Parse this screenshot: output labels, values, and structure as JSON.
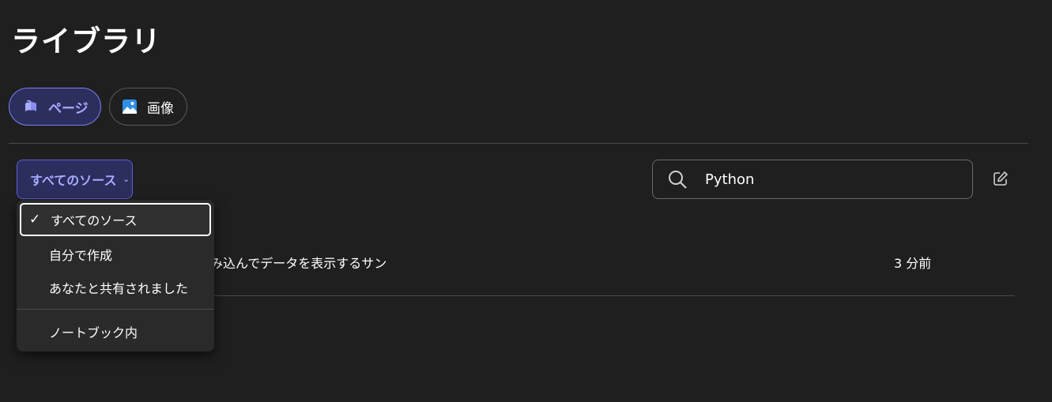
{
  "page": {
    "title": "ライブラリ"
  },
  "tabs": [
    {
      "label": "ページ",
      "icon": "pages-icon",
      "active": true
    },
    {
      "label": "画像",
      "icon": "image-icon",
      "active": false
    }
  ],
  "filter": {
    "label": "すべてのソース",
    "options": [
      {
        "label": "すべてのソース",
        "selected": true
      },
      {
        "label": "自分で作成",
        "selected": false
      },
      {
        "label": "あなたと共有されました",
        "selected": false
      },
      {
        "label": "ノートブック内",
        "selected": false
      }
    ]
  },
  "search": {
    "value": "Python",
    "icon": "search-icon"
  },
  "list": {
    "rows": [
      {
        "name_visible": "み込んでデータを表示するサン",
        "time": "3 分前"
      }
    ]
  },
  "colors": {
    "background": "#1f1f1f",
    "accent": "#a8abff",
    "accent_bg": "#2c2e5e"
  }
}
